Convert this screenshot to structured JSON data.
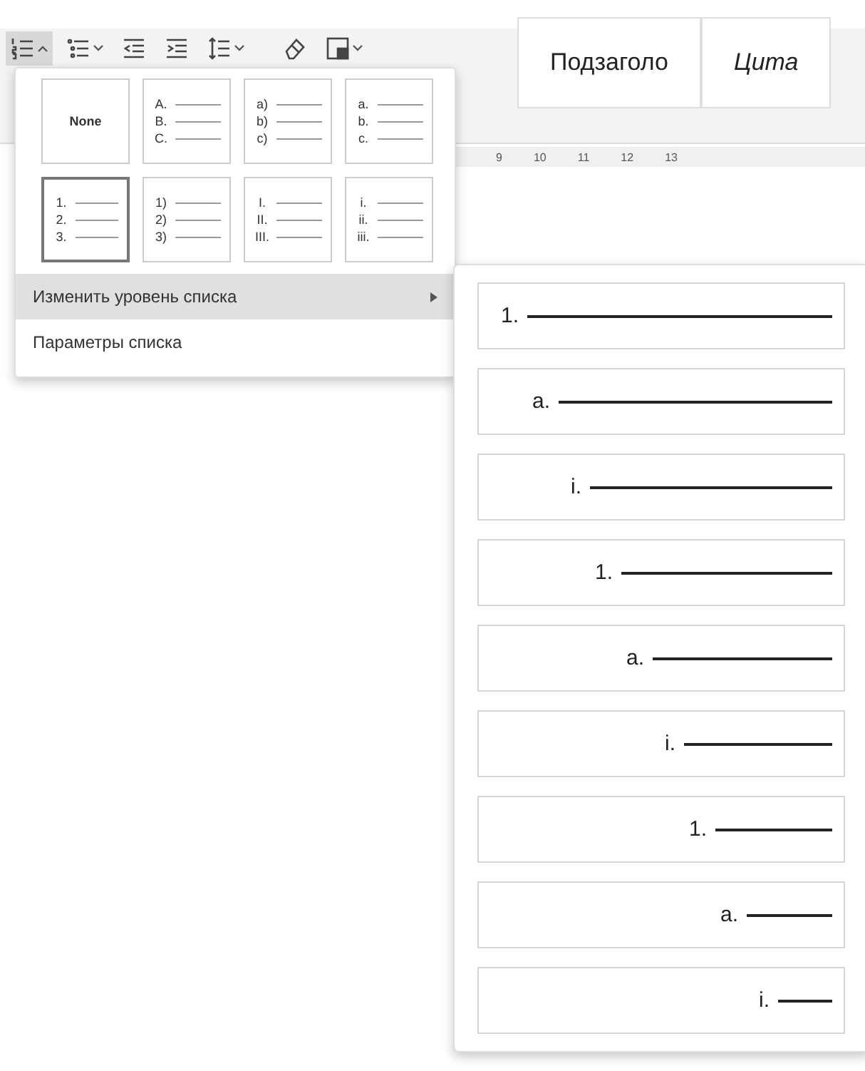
{
  "toolbar": {
    "buttons": [
      {
        "selected": true
      },
      {
        "selected": false
      },
      {
        "selected": false
      },
      {
        "selected": false
      },
      {
        "selected": false
      },
      {
        "selected": false
      },
      {
        "selected": false
      }
    ],
    "styles": [
      {
        "label": "Подзаголо"
      },
      {
        "label": "Цита"
      }
    ]
  },
  "ruler": {
    "numbers": [
      "9",
      "10",
      "11",
      "12",
      "13"
    ]
  },
  "list_menu": {
    "styles": [
      {
        "kind": "none",
        "label": "None",
        "selected": false
      },
      {
        "kind": "markers",
        "markers": [
          "A.",
          "B.",
          "C."
        ],
        "selected": false
      },
      {
        "kind": "markers",
        "markers": [
          "a)",
          "b)",
          "c)"
        ],
        "selected": false
      },
      {
        "kind": "markers",
        "markers": [
          "a.",
          "b.",
          "c."
        ],
        "selected": false
      },
      {
        "kind": "markers",
        "markers": [
          "1.",
          "2.",
          "3."
        ],
        "selected": true
      },
      {
        "kind": "markers",
        "markers": [
          "1)",
          "2)",
          "3)"
        ],
        "selected": false
      },
      {
        "kind": "markers",
        "markers": [
          "I.",
          "II.",
          "III."
        ],
        "selected": false
      },
      {
        "kind": "markers",
        "markers": [
          "i.",
          "ii.",
          "iii."
        ],
        "selected": false
      }
    ],
    "items": [
      {
        "label": "Изменить уровень списка",
        "submenu": true,
        "selected": true
      },
      {
        "label": "Параметры списка",
        "submenu": false,
        "selected": false
      }
    ]
  },
  "level_menu": {
    "levels": [
      {
        "marker": "1."
      },
      {
        "marker": "a."
      },
      {
        "marker": "i."
      },
      {
        "marker": "1."
      },
      {
        "marker": "a."
      },
      {
        "marker": "i."
      },
      {
        "marker": "1."
      },
      {
        "marker": "a."
      },
      {
        "marker": "i."
      }
    ]
  }
}
